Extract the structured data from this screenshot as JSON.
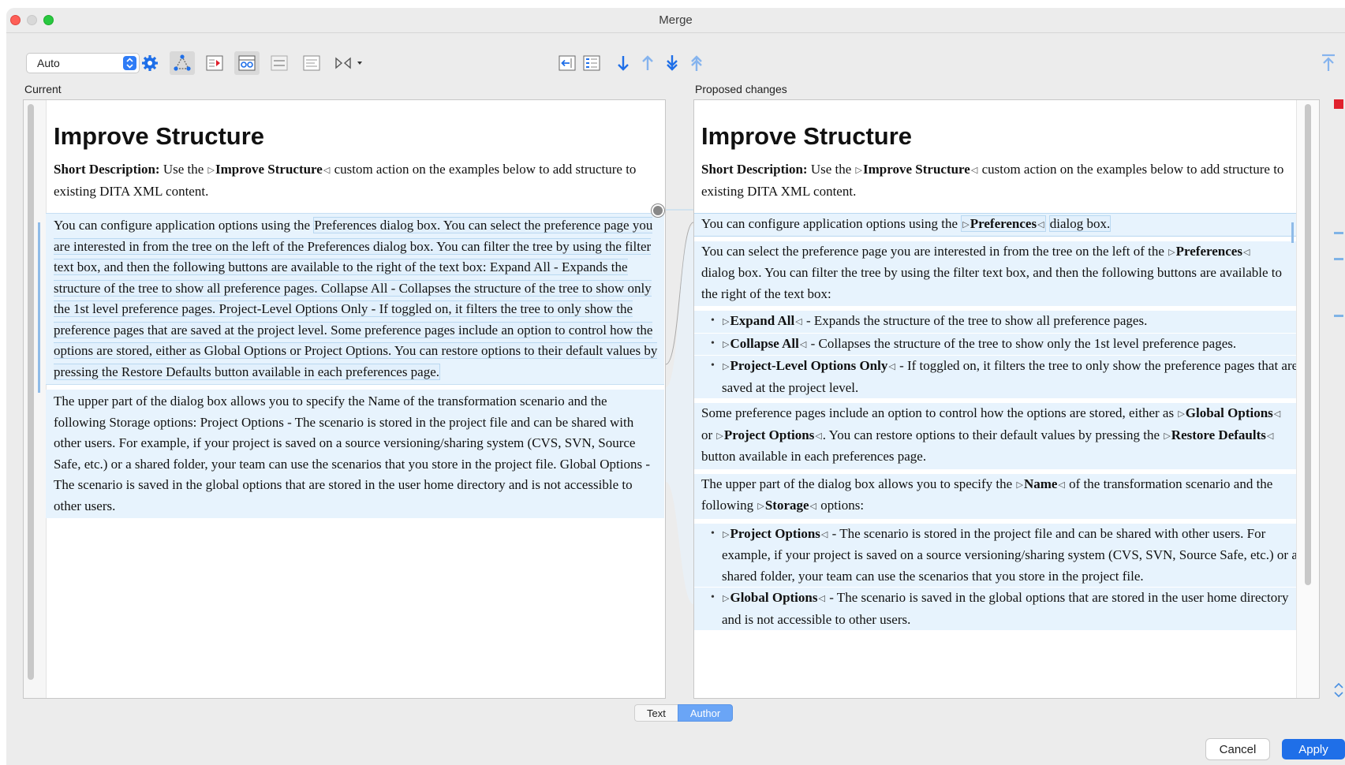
{
  "window": {
    "title": "Merge"
  },
  "toolbar": {
    "mode_combo": "Auto",
    "icons": [
      "settings-gear-icon",
      "three-way-diff-icon",
      "show-changes-icon",
      "sync-scroll-icon",
      "ignore-whitespace-icon",
      "word-level-icon",
      "compare-options-icon",
      "accept-left-icon",
      "accept-all-icon",
      "next-change-icon",
      "previous-change-icon",
      "next-conflict-icon",
      "previous-conflict-icon",
      "scroll-top-icon"
    ]
  },
  "left": {
    "label": "Current",
    "title": "Improve Structure",
    "shortdesc_label": "Short Description:",
    "shortdesc_pre": " Use the ",
    "shortdesc_action": "Improve Structure",
    "shortdesc_post": " custom action on the examples below to add structure to existing DITA XML content.",
    "para1_a": "You can configure application options using the ",
    "para1_b": "Preferences dialog box. You can select the preference page you are interested in from the tree on the left of the Preferences dialog box. You can filter the tree by using the filter text box, and then the following buttons are available to the right of the text box: Expand All - Expands the structure of the tree to show all preference pages. Collapse All - Collapses the structure of the tree to show only the 1st level preference pages. Project-Level Options Only - If toggled on, it filters the tree to only show the preference pages that are saved at the project level. Some preference pages include an option to control how the options are stored, either as Global Options or Project Options. You can restore options to their default values by pressing the Restore Defaults button available in each preferences page.",
    "para2": "The upper part of the dialog box allows you to specify the Name of the transformation scenario and the following Storage options: Project Options - The scenario is stored in the project file and can be shared with other users. For example, if your project is saved on a source versioning/sharing system (CVS, SVN, Source Safe, etc.) or a shared folder, your team can use the scenarios that you store in the project file. Global Options - The scenario is saved in the global options that are stored in the user home directory and is not accessible to other users."
  },
  "right": {
    "label": "Proposed changes",
    "title": "Improve Structure",
    "shortdesc_label": "Short Description:",
    "shortdesc_pre": " Use the ",
    "shortdesc_action": "Improve Structure",
    "shortdesc_post": " custom action on the examples below to add structure to existing DITA XML content.",
    "p1_pre": "You can configure application options using the ",
    "p1_bold": "Preferences",
    "p1_post": "dialog box.",
    "p2_pre": "You can select the preference page you are interested in from the tree on the left of the ",
    "p2_bold": "Preferences",
    "p2_post": "dialog box. You can filter the tree by using the filter text box, and then the following buttons are available to the right of the text box:",
    "li1_bold": "Expand All",
    "li1_text": " - Expands the structure of the tree to show all preference pages.",
    "li2_bold": "Collapse All",
    "li2_text": " - Collapses the structure of the tree to show only the 1st level preference pages.",
    "li3_bold": "Project-Level Options Only",
    "li3_text": " - If toggled on, it filters the tree to only show the preference pages that are saved at the project level.",
    "p3_pre": "Some preference pages include an option to control how the options are stored, either as ",
    "p3_b1": "Global Options",
    "p3_mid1": " or ",
    "p3_b2": "Project Options",
    "p3_mid2": ". You can restore options to their default values by pressing the ",
    "p3_b3": "Restore Defaults",
    "p3_post": " button available in each preferences page.",
    "p4_pre": "The upper part of the dialog box allows you to specify the ",
    "p4_b1": "Name",
    "p4_mid": " of the transformation scenario and the following ",
    "p4_b2": "Storage",
    "p4_post": " options:",
    "li4_bold": "Project Options",
    "li4_text": " - The scenario is stored in the project file and can be shared with other users. For example, if your project is saved on a source versioning/sharing system (CVS, SVN, Source Safe, etc.) or a shared folder, your team can use the scenarios that you store in the project file.",
    "li5_bold": "Global Options",
    "li5_text": " - The scenario is saved in the global options that are stored in the user home directory and is not accessible to other users."
  },
  "modes": {
    "text": "Text",
    "author": "Author",
    "selected": "Author"
  },
  "buttons": {
    "cancel": "Cancel",
    "apply": "Apply"
  },
  "colors": {
    "accent": "#1f6fe8",
    "diff_fill": "#e7f3fd",
    "diff_border": "#b9d8f1",
    "conflict": "#e0212d"
  }
}
